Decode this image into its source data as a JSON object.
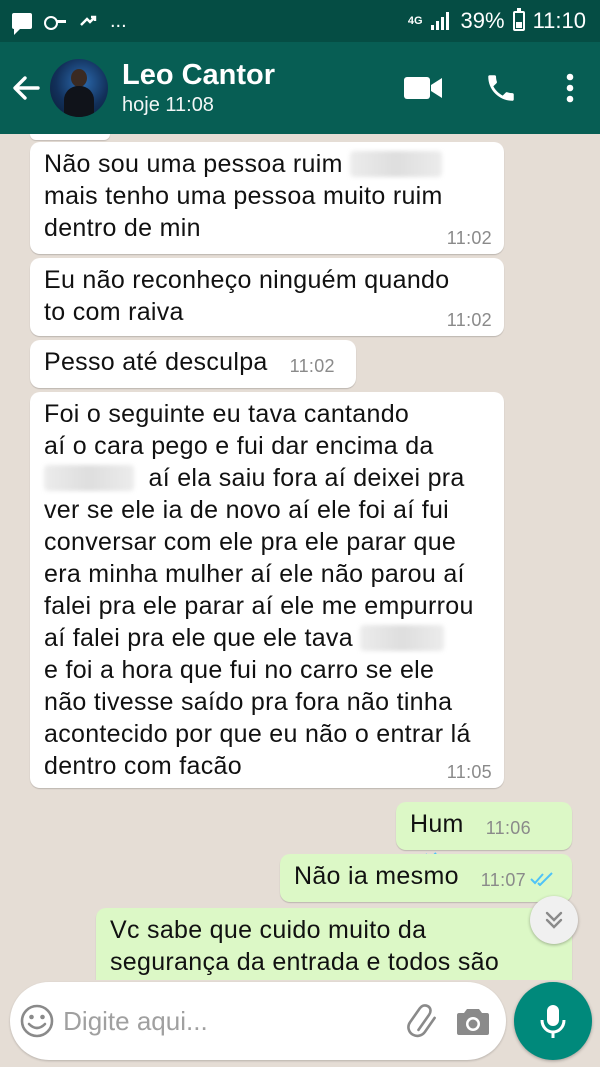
{
  "status_bar": {
    "left_overflow": "...",
    "network": "4G",
    "battery": "39%",
    "time": "11:10",
    "battery_level": 0.39
  },
  "header": {
    "contact_name": "Leo Cantor",
    "last_seen": "hoje 11:08",
    "background": "#075e54"
  },
  "messages": [
    {
      "dir": "in",
      "parts": [
        "Não sou uma pessoa ruim",
        "mais tenho uma pessoa muito ruim",
        "dentro de min"
      ],
      "time": "11:02"
    },
    {
      "dir": "in",
      "parts": [
        "Eu não reconheço ninguém quando",
        "to com raiva"
      ],
      "time": "11:02"
    },
    {
      "dir": "in",
      "parts": [
        "Pesso até desculpa"
      ],
      "time": "11:02"
    },
    {
      "dir": "in",
      "parts": [
        "Foi o seguinte eu tava cantando",
        "aí o cara pego e fui dar encima da",
        "aí ela saiu fora aí deixei pra",
        "ver se ele ia de novo aí ele foi aí fui",
        "conversar com ele pra ele parar que",
        "era minha mulher aí ele não parou aí",
        "falei pra ele parar aí ele me empurrou",
        "aí falei pra ele que ele tava",
        "e foi a hora que fui no carro se ele",
        "não tivesse saído pra fora não tinha",
        "acontecido por que eu não o entrar lá",
        "dentro com facão"
      ],
      "time": "11:05"
    },
    {
      "dir": "out",
      "parts": [
        "Hum"
      ],
      "time": "11:06",
      "status": "read"
    },
    {
      "dir": "out",
      "parts": [
        "Não ia mesmo"
      ],
      "time": "11:07",
      "status": "read"
    },
    {
      "dir": "out",
      "parts": [
        "Vc sabe que cuido muito da",
        "segurança da entrada e todos são"
      ]
    }
  ],
  "composer": {
    "placeholder": "Digite aqui..."
  },
  "colors": {
    "chat_bg": "#e5ddd5",
    "outgoing": "#dcf8c6",
    "incoming": "#ffffff",
    "read_ticks": "#4fc3f7",
    "accent": "#00897b"
  }
}
